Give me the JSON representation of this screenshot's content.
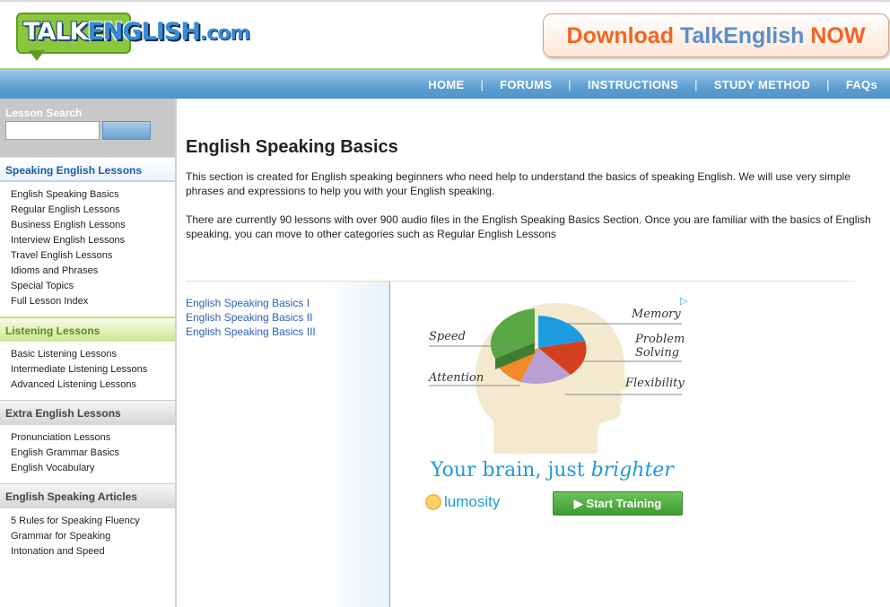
{
  "header": {
    "logo_text": "TALKENGLISH.com",
    "download_banner": {
      "part1": "Download",
      "part2": "TalkEnglish",
      "part3": "NOW"
    }
  },
  "nav": {
    "items": [
      "HOME",
      "FORUMS",
      "INSTRUCTIONS",
      "STUDY METHOD",
      "FAQs"
    ],
    "separator": "|"
  },
  "sidebar": {
    "search_label": "Lesson Search",
    "search_value": "",
    "sections": [
      {
        "title": "Speaking English Lessons",
        "items": [
          "English Speaking Basics",
          "Regular English Lessons",
          "Business English Lessons",
          "Interview English Lessons",
          "Travel English Lessons",
          "Idioms and Phrases",
          "Special Topics",
          "Full Lesson Index"
        ]
      },
      {
        "title": "Listening Lessons",
        "items": [
          "Basic Listening Lessons",
          "Intermediate Listening Lessons",
          "Advanced Listening Lessons"
        ]
      },
      {
        "title": "Extra English Lessons",
        "items": [
          "Pronunciation Lessons",
          "English Grammar Basics",
          "English Vocabulary"
        ]
      },
      {
        "title": "English Speaking Articles",
        "items": [
          "5 Rules for Speaking Fluency",
          "Grammar for Speaking",
          "Intonation and Speed"
        ]
      }
    ]
  },
  "main": {
    "title": "English Speaking Basics",
    "para1": "This section is created for English speaking beginners who need help to understand the basics of speaking English. We will use very simple phrases and expressions to help you with your English speaking.",
    "para2": "There are currently 90 lessons with over 900 audio files in the English Speaking Basics Section. Once you are familiar with the basics of English speaking, you can move to other categories such as Regular English Lessons",
    "sublinks": [
      "English Speaking Basics I",
      "English Speaking Basics II",
      "English Speaking Basics III"
    ]
  },
  "ad": {
    "labels": {
      "speed": "Speed",
      "memory": "Memory",
      "problem1": "Problem",
      "problem2": "Solving",
      "attention": "Attention",
      "flexibility": "Flexibility"
    },
    "tagline_plain": "Your brain, just ",
    "tagline_italic": "brighter",
    "brand": "lumosity",
    "cta": "Start Training",
    "ad_choices_icon": "ad-choices-icon"
  },
  "colors": {
    "nav_blue": "#5e9fd2",
    "link_blue": "#2b63b5",
    "section_blue": "#1c5aa8",
    "section_green": "#5a8a1a",
    "cta_green": "#3f9b33",
    "brand_orange": "#f26522"
  }
}
